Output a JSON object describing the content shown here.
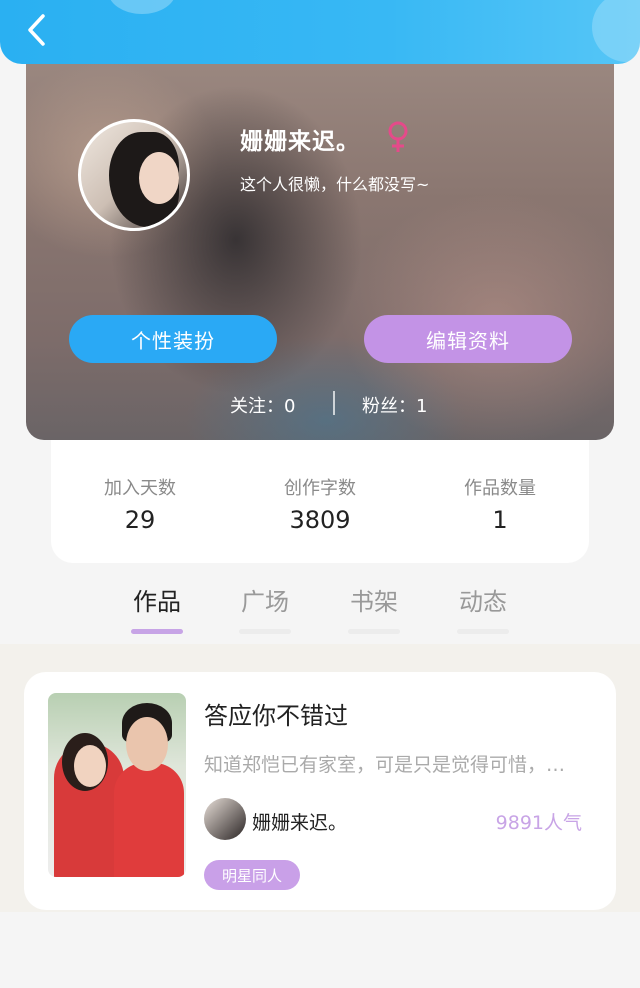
{
  "header": {
    "back_icon": "chevron-left-icon",
    "accent_color": "#2ab0f2"
  },
  "profile": {
    "username": "姗姗来迟。",
    "gender_icon": "female-icon",
    "gender_color": "#e54a8a",
    "bio": "这个人很懒，什么都没写~",
    "dressup_label": "个性装扮",
    "edit_label": "编辑资料",
    "following_text": "关注：0",
    "fans_text": "粉丝：1"
  },
  "stats": [
    {
      "label": "加入天数",
      "value": "29"
    },
    {
      "label": "创作字数",
      "value": "3809"
    },
    {
      "label": "作品数量",
      "value": "1"
    }
  ],
  "tabs": [
    {
      "label": "作品",
      "active": true
    },
    {
      "label": "广场",
      "active": false
    },
    {
      "label": "书架",
      "active": false
    },
    {
      "label": "动态",
      "active": false
    }
  ],
  "works": [
    {
      "title": "答应你不错过",
      "description": "知道郑恺已有家室，可是只是觉得可惜，…",
      "author": "姗姗来迟。",
      "popularity": "9891人气",
      "tag": "明星同人"
    }
  ]
}
